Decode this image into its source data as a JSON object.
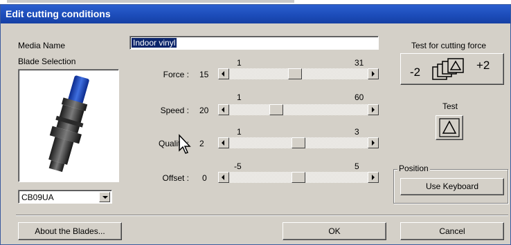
{
  "window": {
    "title": "Edit cutting conditions"
  },
  "media": {
    "label": "Media Name",
    "value": "Indoor vinyl"
  },
  "blade": {
    "label": "Blade Selection",
    "selected": "CB09UA"
  },
  "sliders": [
    {
      "id": "force",
      "label": "Force :",
      "value": "15",
      "min": "1",
      "max": "31",
      "fraction": 0.47
    },
    {
      "id": "speed",
      "label": "Speed :",
      "value": "20",
      "min": "1",
      "max": "60",
      "fraction": 0.32
    },
    {
      "id": "quality",
      "label": "Quality :",
      "value": "2",
      "min": "1",
      "max": "3",
      "fraction": 0.5
    },
    {
      "id": "offset",
      "label": "Offset :",
      "value": "0",
      "min": "-5",
      "max": "5",
      "fraction": 0.5
    }
  ],
  "cutting_force_test": {
    "label": "Test for cutting force",
    "minus": "-2",
    "plus": "+2"
  },
  "test": {
    "label": "Test"
  },
  "position": {
    "legend": "Position",
    "button": "Use Keyboard"
  },
  "buttons": {
    "about": "About the Blades...",
    "ok": "OK",
    "cancel": "Cancel"
  },
  "colors": {
    "titlebar": "#1b4bb8",
    "selection": "#0a246a",
    "dialog": "#d4d0c8"
  }
}
